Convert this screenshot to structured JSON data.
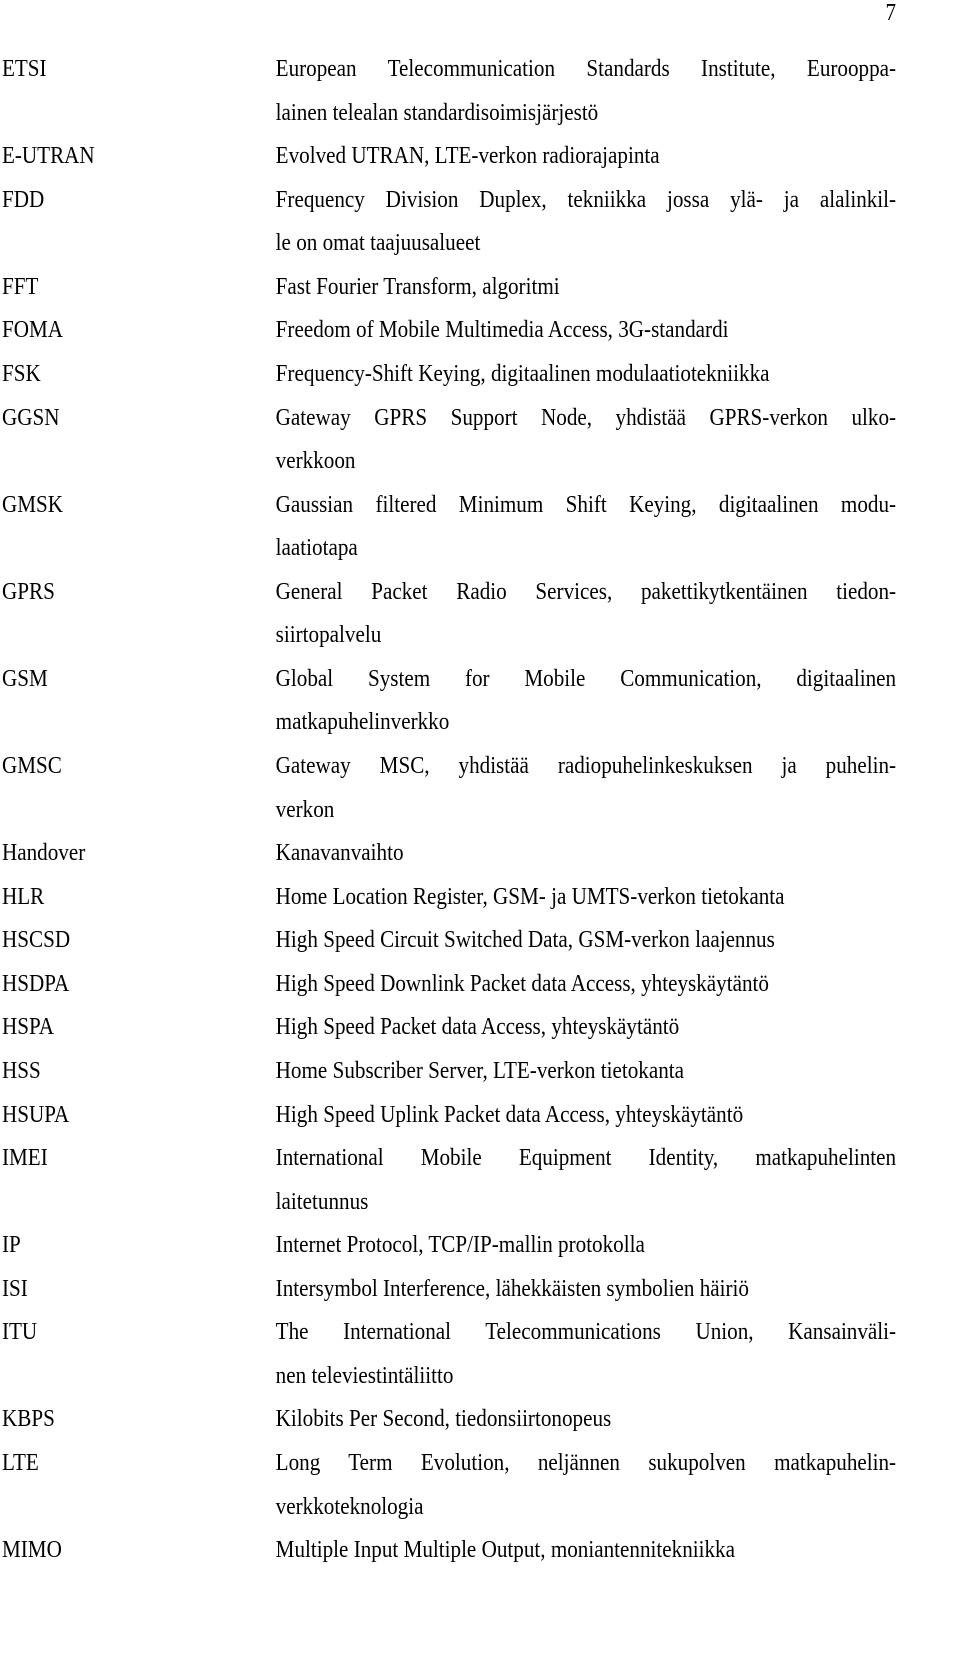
{
  "page_number": "7",
  "entries": [
    {
      "abbr": "ETSI",
      "lines": [
        "European Telecommunication Standards Institute, Eurooppa-",
        "lainen telealan standardisoimisjärjestö"
      ]
    },
    {
      "abbr": "E-UTRAN",
      "lines": [
        "Evolved UTRAN, LTE-verkon radiorajapinta"
      ]
    },
    {
      "abbr": "FDD",
      "lines": [
        "Frequency Division Duplex, tekniikka jossa ylä- ja alalinkil-",
        "le on omat taajuusalueet"
      ]
    },
    {
      "abbr": "FFT",
      "lines": [
        "Fast Fourier Transform, algoritmi"
      ]
    },
    {
      "abbr": "FOMA",
      "lines": [
        "Freedom of Mobile Multimedia Access, 3G-standardi"
      ]
    },
    {
      "abbr": "FSK",
      "lines": [
        "Frequency-Shift Keying, digitaalinen modulaatiotekniikka"
      ]
    },
    {
      "abbr": "GGSN",
      "lines": [
        "Gateway GPRS Support Node, yhdistää GPRS-verkon ulko-",
        "verkkoon"
      ]
    },
    {
      "abbr": "GMSK",
      "lines": [
        "Gaussian filtered Minimum Shift Keying, digitaalinen modu-",
        "laatiotapa"
      ]
    },
    {
      "abbr": "GPRS",
      "lines": [
        "General Packet Radio Services, pakettikytkentäinen tiedon-",
        "siirtopalvelu"
      ]
    },
    {
      "abbr": "GSM",
      "lines": [
        "Global System for Mobile Communication, digitaalinen",
        "matkapuhelinverkko"
      ]
    },
    {
      "abbr": "GMSC",
      "lines": [
        "Gateway MSC, yhdistää radiopuhelinkeskuksen ja puhelin-",
        "verkon"
      ]
    },
    {
      "abbr": "Handover",
      "lines": [
        "Kanavanvaihto"
      ]
    },
    {
      "abbr": "HLR",
      "lines": [
        "Home Location Register, GSM- ja UMTS-verkon tietokanta"
      ]
    },
    {
      "abbr": "HSCSD",
      "lines": [
        "High Speed Circuit Switched Data, GSM-verkon laajennus"
      ]
    },
    {
      "abbr": "HSDPA",
      "lines": [
        "High Speed Downlink Packet data Access, yhteyskäytäntö"
      ]
    },
    {
      "abbr": "HSPA",
      "lines": [
        "High Speed Packet data Access, yhteyskäytäntö"
      ]
    },
    {
      "abbr": "HSS",
      "lines": [
        "Home Subscriber Server, LTE-verkon tietokanta"
      ]
    },
    {
      "abbr": "HSUPA",
      "lines": [
        "High Speed Uplink Packet data Access, yhteyskäytäntö"
      ]
    },
    {
      "abbr": "IMEI",
      "lines": [
        "International Mobile Equipment Identity, matkapuhelinten",
        "laitetunnus"
      ]
    },
    {
      "abbr": "IP",
      "lines": [
        "Internet Protocol, TCP/IP-mallin protokolla"
      ]
    },
    {
      "abbr": "ISI",
      "lines": [
        "Intersymbol Interference, lähekkäisten symbolien häiriö"
      ]
    },
    {
      "abbr": "ITU",
      "lines": [
        "The International Telecommunications Union, Kansainväli-",
        "nen televiestintäliitto"
      ]
    },
    {
      "abbr": "KBPS",
      "lines": [
        "Kilobits Per Second, tiedonsiirtonopeus"
      ]
    },
    {
      "abbr": "LTE",
      "lines": [
        "Long Term Evolution, neljännen sukupolven matkapuhelin-",
        "verkkoteknologia"
      ]
    },
    {
      "abbr": "MIMO",
      "lines": [
        "Multiple Input Multiple Output, moniantennitekniikka"
      ]
    }
  ]
}
